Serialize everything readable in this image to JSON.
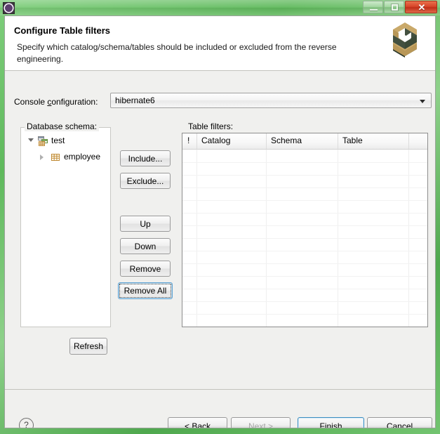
{
  "window": {
    "icon": "gear-icon",
    "minimize_label": "—",
    "maximize_label": "□",
    "close_label": "✕"
  },
  "header": {
    "title": "Configure Table filters",
    "description": "Specify which catalog/schema/tables should be included or excluded from the reverse engineering.",
    "logo": "hibernate-logo"
  },
  "console_configuration": {
    "label": "Console configuration:",
    "value": "hibernate6",
    "dropdown_icon": "chevron-down-icon"
  },
  "database_schema": {
    "label": "Database schema:",
    "tree": [
      {
        "label": "test",
        "icon": "schema-icon",
        "expanded": true,
        "depth": 0
      },
      {
        "label": "employee",
        "icon": "table-icon",
        "expanded": false,
        "depth": 1
      }
    ]
  },
  "actions": {
    "include": "Include...",
    "exclude": "Exclude...",
    "up": "Up",
    "down": "Down",
    "remove": "Remove",
    "remove_all": "Remove All",
    "refresh": "Refresh"
  },
  "table_filters": {
    "label": "Table filters:",
    "columns": [
      "!",
      "Catalog",
      "Schema",
      "Table",
      ""
    ],
    "rows": []
  },
  "footer": {
    "help": "?",
    "back": "< Back",
    "next": "Next >",
    "finish": "Finish",
    "cancel": "Cancel"
  },
  "colors": {
    "accent": "#3d8ec0",
    "focus": "#5a9fd0",
    "dialog_bg": "#f0f0ee",
    "header_bg": "#ffffff",
    "close_button": "#d8472b",
    "desktop": "#5fb95c"
  }
}
